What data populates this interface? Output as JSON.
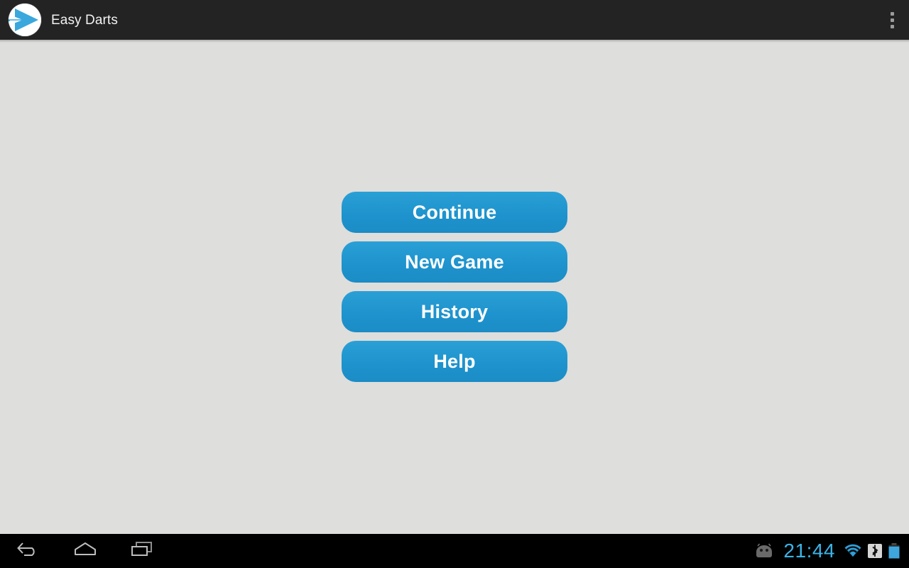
{
  "app": {
    "title": "Easy Darts",
    "icon": "darts-arrow-logo-icon",
    "accent_color": "#1f96cf",
    "action_bar_color": "#232323",
    "background_color": "#dededc"
  },
  "action_bar": {
    "overflow_label": "More options",
    "overflow_icon": "overflow-menu-icon"
  },
  "main_menu": {
    "buttons": [
      {
        "label": "Continue",
        "name": "continue-button"
      },
      {
        "label": "New Game",
        "name": "new-game-button"
      },
      {
        "label": "History",
        "name": "history-button"
      },
      {
        "label": "Help",
        "name": "help-button"
      }
    ]
  },
  "navigation_bar": {
    "buttons": [
      {
        "label": "Back",
        "icon": "back-arrow-icon"
      },
      {
        "label": "Home",
        "icon": "home-icon"
      },
      {
        "label": "Recent apps",
        "icon": "recent-apps-icon"
      }
    ],
    "status": {
      "debug_icon": "android-debug-icon",
      "time": "21:44",
      "time_color": "#3cb4e8",
      "wifi_icon": "wifi-icon",
      "bluetooth_icon": "bluetooth-icon",
      "battery_icon": "battery-full-icon"
    }
  }
}
